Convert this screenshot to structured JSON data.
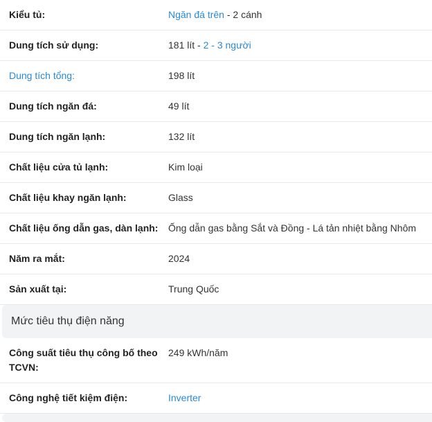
{
  "specs_group_1": [
    {
      "label": "Kiểu tủ:",
      "label_link": false,
      "value_parts": [
        {
          "text": "Ngăn đá trên",
          "link": true
        },
        {
          "text": " - 2 cánh",
          "link": false
        }
      ]
    },
    {
      "label": "Dung tích sử dụng:",
      "label_link": false,
      "value_parts": [
        {
          "text": "181 lít - ",
          "link": false
        },
        {
          "text": "2 - 3 người",
          "link": true
        }
      ]
    },
    {
      "label": "Dung tích tổng:",
      "label_link": true,
      "value_parts": [
        {
          "text": "198 lít",
          "link": false
        }
      ]
    },
    {
      "label": "Dung tích ngăn đá:",
      "label_link": false,
      "value_parts": [
        {
          "text": "49 lít",
          "link": false
        }
      ]
    },
    {
      "label": "Dung tích ngăn lạnh:",
      "label_link": false,
      "value_parts": [
        {
          "text": "132 lít",
          "link": false
        }
      ]
    },
    {
      "label": "Chất liệu cửa tủ lạnh:",
      "label_link": false,
      "value_parts": [
        {
          "text": "Kim loại",
          "link": false
        }
      ]
    },
    {
      "label": "Chất liệu khay ngăn lạnh:",
      "label_link": false,
      "value_parts": [
        {
          "text": "Glass",
          "link": false
        }
      ]
    },
    {
      "label": "Chất liệu ống dẫn gas, dàn lạnh:",
      "label_link": false,
      "value_parts": [
        {
          "text": "Ống dẫn gas bằng Sắt và Đồng - Lá tản nhiệt bằng Nhôm",
          "link": false
        }
      ]
    },
    {
      "label": "Năm ra mắt:",
      "label_link": false,
      "value_parts": [
        {
          "text": "2024",
          "link": false
        }
      ]
    },
    {
      "label": "Sản xuất tại:",
      "label_link": false,
      "value_parts": [
        {
          "text": "Trung Quốc",
          "link": false
        }
      ]
    }
  ],
  "section_title": "Mức tiêu thụ điện năng",
  "specs_group_2": [
    {
      "label": "Công suất tiêu thụ công bố theo TCVN:",
      "label_link": false,
      "value_parts": [
        {
          "text": "249 kWh/năm",
          "link": false
        }
      ]
    },
    {
      "label": "Công nghệ tiết kiệm điện:",
      "label_link": false,
      "value_parts": [
        {
          "text": "Inverter",
          "link": true
        }
      ]
    }
  ],
  "colors": {
    "link": "#288ad6",
    "section_bg": "#f2f3f5",
    "divider": "#e8e8e8"
  }
}
